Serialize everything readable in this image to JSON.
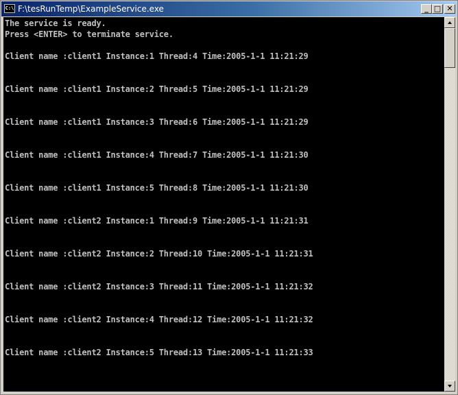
{
  "window": {
    "title": "F:\\tesRunTemp\\ExampleService.exe",
    "icon": "console-icon",
    "icon_text": "C:\\",
    "controls": {
      "minimize": "_",
      "maximize": "□",
      "close": "✕"
    }
  },
  "console": {
    "lines": [
      "The service is ready.",
      "Press <ENTER> to terminate service.",
      "Client name :client1 Instance:1 Thread:4 Time:2005-1-1 11:21:29",
      "Client name :client1 Instance:2 Thread:5 Time:2005-1-1 11:21:29",
      "Client name :client1 Instance:3 Thread:6 Time:2005-1-1 11:21:29",
      "Client name :client1 Instance:4 Thread:7 Time:2005-1-1 11:21:30",
      "Client name :client1 Instance:5 Thread:8 Time:2005-1-1 11:21:30",
      "Client name :client2 Instance:1 Thread:9 Time:2005-1-1 11:21:31",
      "Client name :client2 Instance:2 Thread:10 Time:2005-1-1 11:21:31",
      "Client name :client2 Instance:3 Thread:11 Time:2005-1-1 11:21:32",
      "Client name :client2 Instance:4 Thread:12 Time:2005-1-1 11:21:32",
      "Client name :client2 Instance:5 Thread:13 Time:2005-1-1 11:21:33"
    ]
  },
  "colors": {
    "console_bg": "#000000",
    "console_text": "#c0c0c0",
    "titlebar_start": "#0a246a",
    "titlebar_end": "#a6caf0"
  }
}
